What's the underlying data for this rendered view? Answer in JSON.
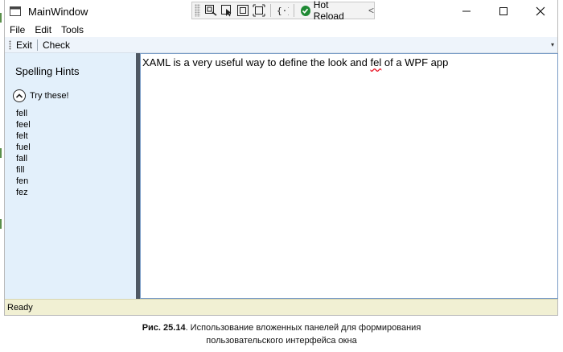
{
  "window": {
    "title": "MainWindow"
  },
  "debug_toolbar": {
    "hot_reload_label": "Hot Reload",
    "collapse_glyph": "<"
  },
  "menu": {
    "items": [
      "File",
      "Edit",
      "Tools"
    ]
  },
  "toolbar": {
    "exit_label": "Exit",
    "check_label": "Check",
    "overflow_glyph": "▾"
  },
  "sidebar": {
    "title": "Spelling Hints",
    "expander_label": "Try these!",
    "hints": [
      "fell",
      "feel",
      "felt",
      "fuel",
      "fall",
      "fill",
      "fen",
      "fez"
    ]
  },
  "editor": {
    "text_before": "XAML is a very useful way to define the look and ",
    "misspelled_word": "fel",
    "text_after": " of a WPF app"
  },
  "status": {
    "text": "Ready"
  },
  "caption": {
    "figure_label": "Рис. 25.14",
    "line1": ". Использование вложенных панелей для формирования",
    "line2": "пользовательского интерфейса окна"
  },
  "colors": {
    "sidebar_bg": "#e3f0fb",
    "status_bg": "#f1f0d3",
    "splitter": "#4f5863",
    "hot_reload_ok": "#1f8a34"
  }
}
